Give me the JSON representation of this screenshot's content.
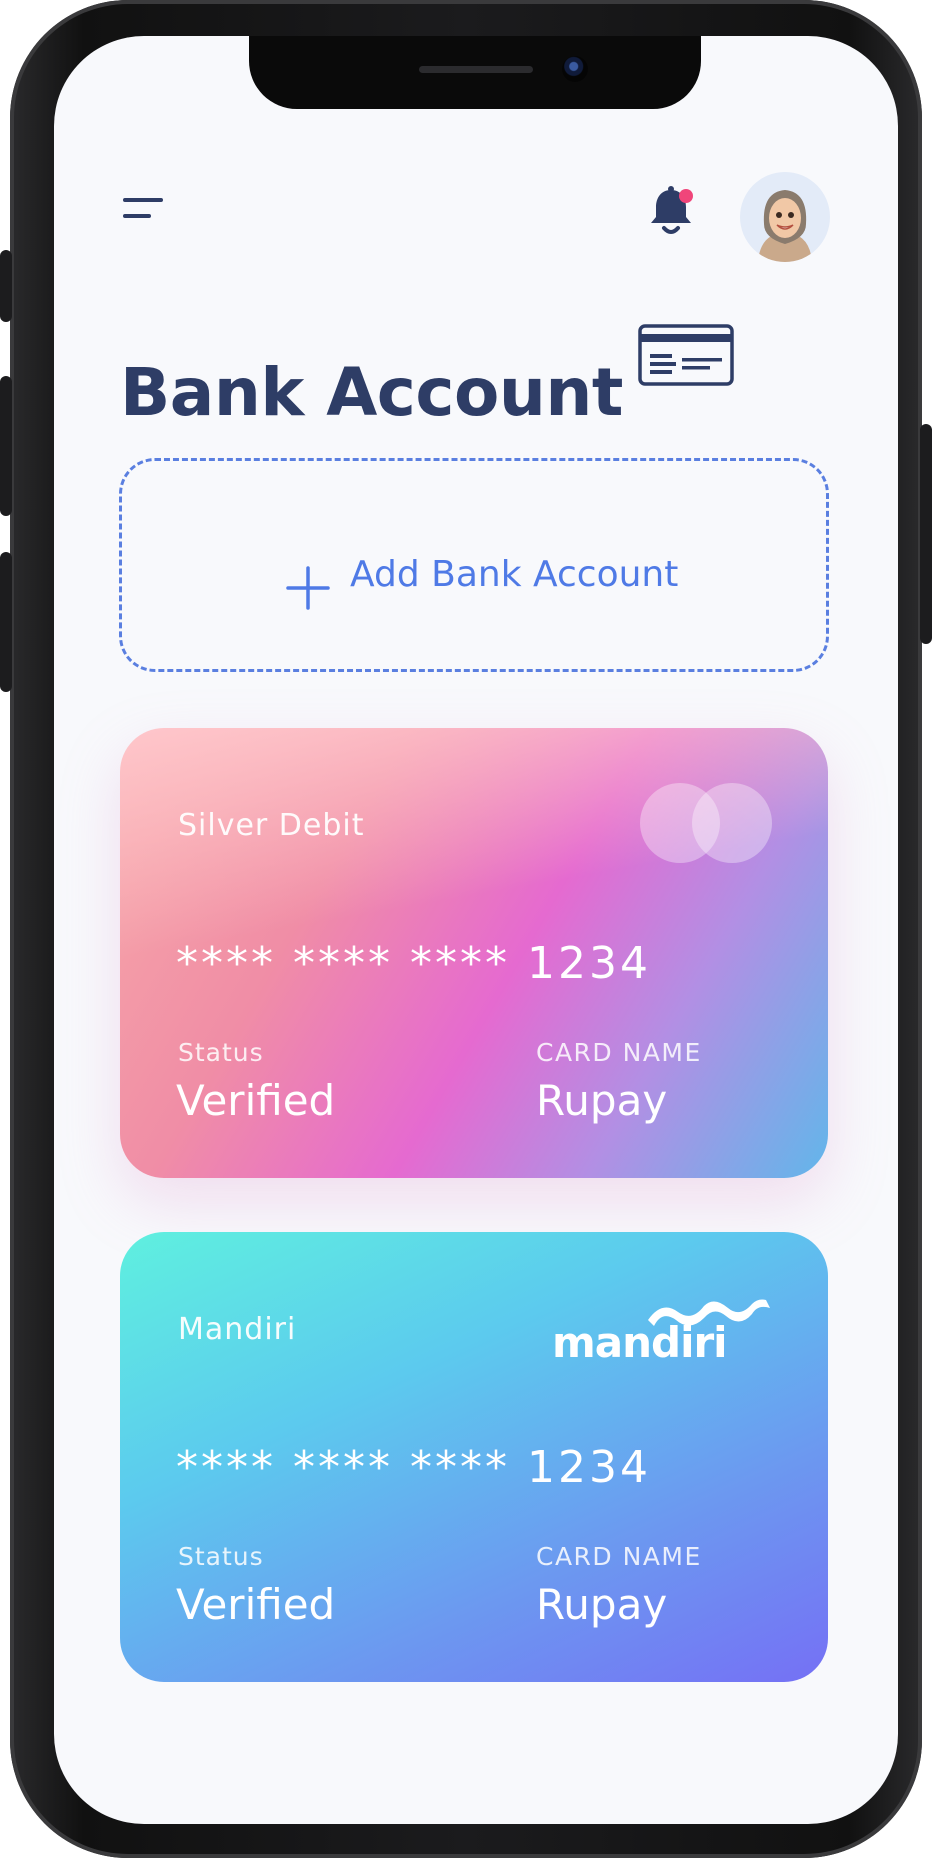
{
  "header": {
    "menu_icon": "hamburger-menu-icon",
    "notification_icon": "bell-icon",
    "notification_dot_color": "#f0457a",
    "avatar": "user-avatar"
  },
  "page": {
    "title": "Bank Account",
    "title_icon": "bank-card-icon"
  },
  "add_account": {
    "icon": "plus-icon",
    "label": "Add Bank Account",
    "accent_color": "#4f7ae6"
  },
  "cards": [
    {
      "name": "Silver Debit",
      "number": "**** **** **** 1234",
      "status_label": "Status",
      "status_value": "Verified",
      "card_name_label": "CARD NAME",
      "card_name_value": "Rupay",
      "logo": "mastercard-circles-icon"
    },
    {
      "name": "Mandiri",
      "number": "**** **** **** 1234",
      "status_label": "Status",
      "status_value": "Verified",
      "card_name_label": "CARD NAME",
      "card_name_value": "Rupay",
      "logo": "mandiri",
      "logo_text": "mandiri"
    }
  ],
  "colors": {
    "primary_text": "#2e3d66",
    "background": "#f8f9fc"
  }
}
